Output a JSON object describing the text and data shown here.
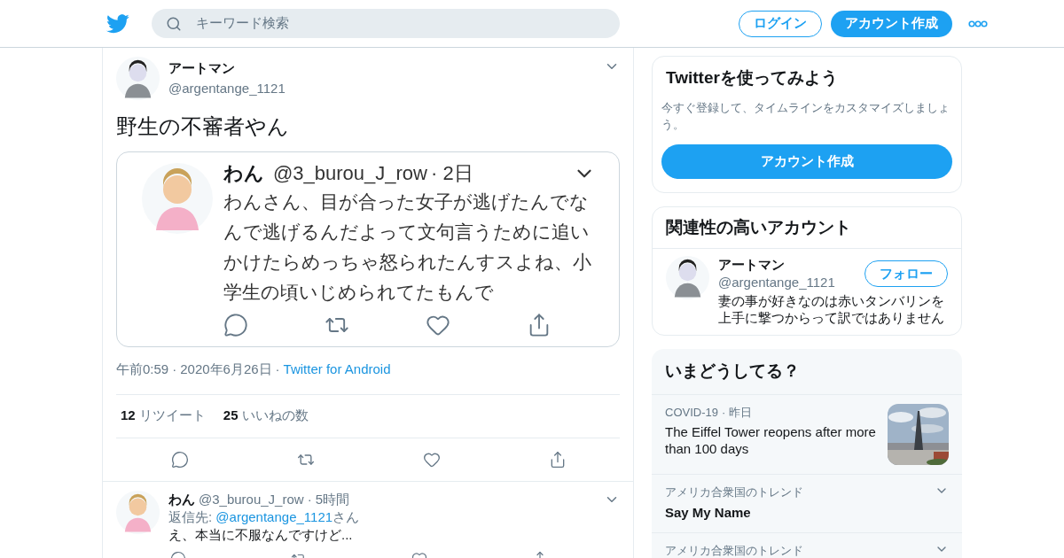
{
  "separator": "·",
  "header": {
    "search": {
      "placeholder": "キーワード検索"
    },
    "login": "ログイン",
    "signup": "アカウント作成"
  },
  "tweet": {
    "name": "アートマン",
    "handle": "@argentange_1121",
    "text": "野生の不審者やん",
    "embed": {
      "name": "わん",
      "handle": "@3_burou_J_row",
      "time": "· 2日",
      "text": "わんさん、目が合った女子が逃げたんでなんで逃げるんだよって文句言うために追いかけたらめっちゃ怒られたんすスよね、小学生の頃いじめられてたもんで"
    },
    "meta": {
      "time": "午前0:59",
      "date": "2020年6月26日",
      "source": "Twitter for Android"
    },
    "stats": [
      {
        "count": "12",
        "label": "リツイート"
      },
      {
        "count": "25",
        "label": "いいねの数"
      }
    ]
  },
  "reply": {
    "name": "わん",
    "handle": "@3_burou_J_row",
    "time": "5時間",
    "reply_prefix": "返信先:",
    "reply_handle": "@argentange_1121",
    "reply_suffix": "さん",
    "text": "え、本当に不服なんですけど..."
  },
  "signup_card": {
    "title": "Twitterを使ってみよう",
    "text": "今すぐ登録して、タイムラインをカスタマイズしましょう。",
    "button": "アカウント作成"
  },
  "related": {
    "title": "関連性の高いアカウント",
    "accounts": [
      {
        "name": "アートマン",
        "handle": "@argentange_1121",
        "bio": "妻の事が好きなのは赤いタンバリンを上手に撃つからって訳ではありません",
        "button": "フォロー"
      }
    ]
  },
  "trends": {
    "title": "いまどうしてる？",
    "items": [
      {
        "kind": "news",
        "context": "COVID-19",
        "time": "昨日",
        "title": "The Eiffel Tower reopens after more than 100 days"
      },
      {
        "kind": "trend",
        "context": "アメリカ合衆国のトレンド",
        "title": "Say My Name"
      },
      {
        "kind": "trend",
        "context": "アメリカ合衆国のトレンド"
      }
    ]
  }
}
